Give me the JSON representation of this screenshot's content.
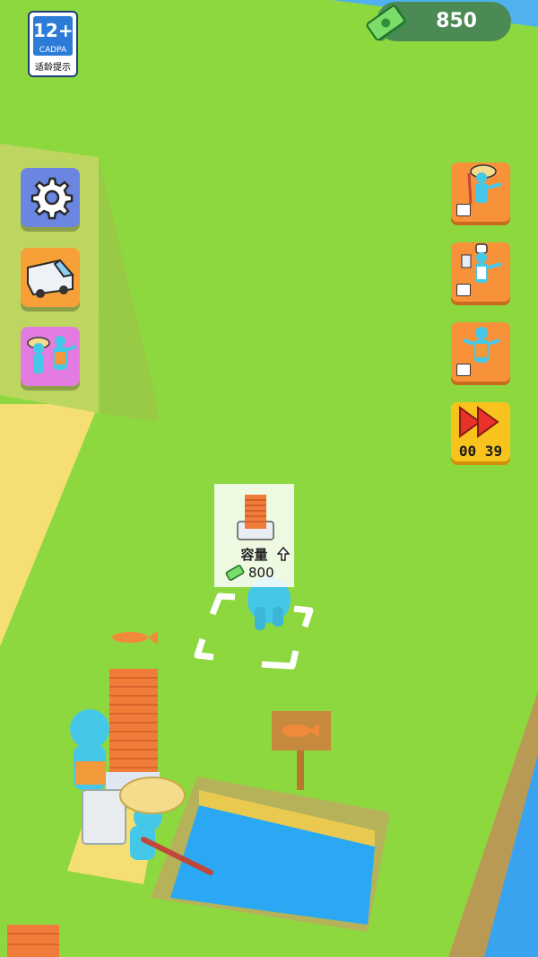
{
  "cadpa": {
    "age": "12+",
    "brand": "CADPA",
    "caption": "适龄提示"
  },
  "money": {
    "value": "850",
    "icon": "cash-icon"
  },
  "left_menu": [
    {
      "name": "settings-button",
      "icon": "gear-icon"
    },
    {
      "name": "van-button",
      "icon": "van-icon"
    },
    {
      "name": "staff-button",
      "icon": "staff-group-icon"
    }
  ],
  "right_menu": [
    {
      "name": "hire-fisher-button",
      "icon": "fisher-worker-icon",
      "badge": "video-icon"
    },
    {
      "name": "hire-chef-button",
      "icon": "chef-worker-icon",
      "badge": "video-icon"
    },
    {
      "name": "hire-cashier-button",
      "icon": "cashier-worker-icon",
      "badge": "video-icon"
    }
  ],
  "speedup": {
    "icon": "fast-forward-icon",
    "timer": "00 39"
  },
  "upgrade": {
    "label": "容量",
    "price": "800",
    "icon": "fish-stack-icon",
    "arrow": "up-arrow-icon",
    "price_icon": "cash-icon"
  },
  "colors": {
    "grass": "#8ed83f",
    "sand": "#f4dd72",
    "water": "#2aa8f4",
    "orange_btn": "#f7923a",
    "blue_btn": "#6a86e0",
    "pink_btn": "#e37be0",
    "yellow_btn": "#f7c31c"
  }
}
